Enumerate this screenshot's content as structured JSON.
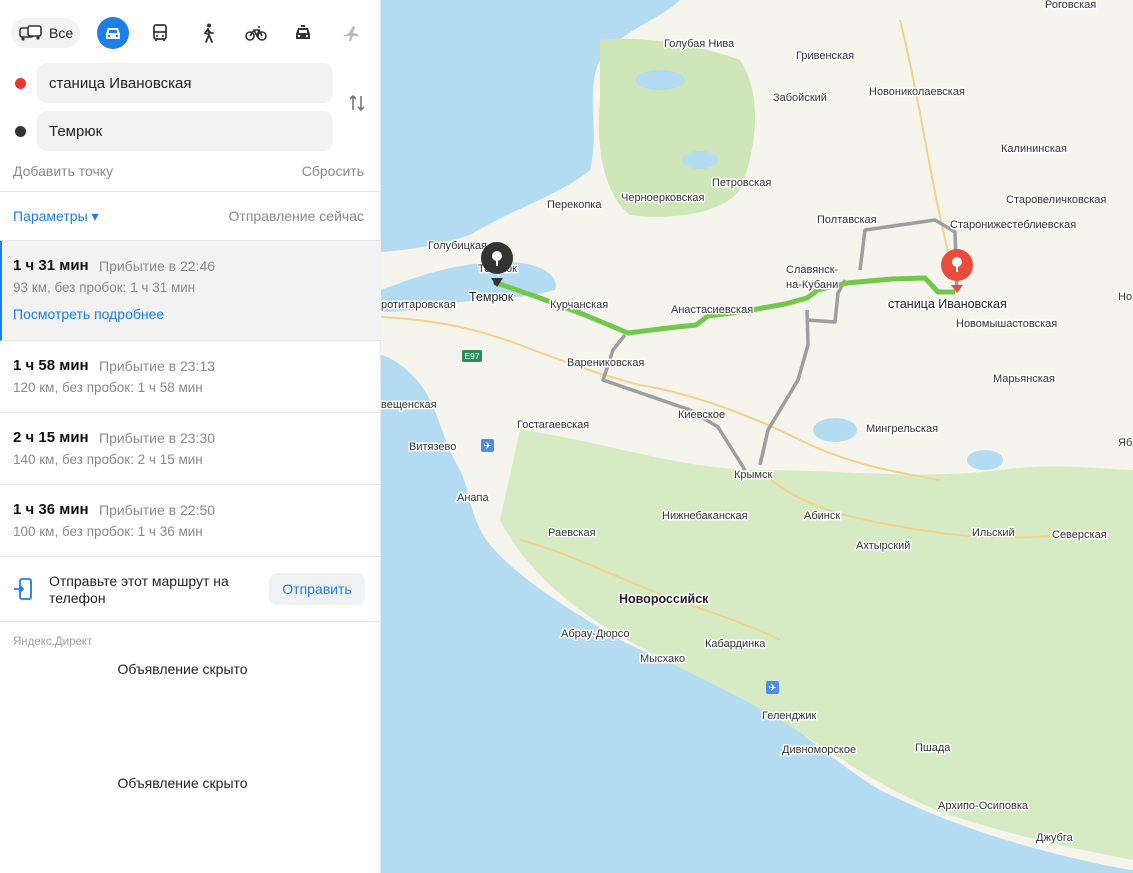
{
  "transport_modes": {
    "all_label": "Все",
    "modes": [
      "car-icon",
      "bus-icon",
      "walk-icon",
      "bike-icon",
      "taxi-icon",
      "plane-icon"
    ],
    "active": "car-icon"
  },
  "route_points": {
    "from": "станица Ивановская",
    "to": "Темрюк",
    "from_color": "#e8372f",
    "to_color": "#333333"
  },
  "actions": {
    "add_point": "Добавить точку",
    "reset": "Сбросить",
    "params": "Параметры ▾",
    "departure": "Отправление сейчас"
  },
  "routes": [
    {
      "duration": "1 ч 31 мин",
      "arrival": "Прибытие в 22:46",
      "distance": "93 км, без пробок: 1 ч 31 мин",
      "details": "Посмотреть подробнее",
      "selected": true
    },
    {
      "duration": "1 ч 58 мин",
      "arrival": "Прибытие в 23:13",
      "distance": "120 км, без пробок: 1 ч 58 мин"
    },
    {
      "duration": "2 ч 15 мин",
      "arrival": "Прибытие в 23:30",
      "distance": "140 км, без пробок: 2 ч 15 мин"
    },
    {
      "duration": "1 ч 36 мин",
      "arrival": "Прибытие в 22:50",
      "distance": "100 км, без пробок: 1 ч 36 мин"
    }
  ],
  "send": {
    "text": "Отправьте этот маршрут на телефон",
    "button": "Отправить"
  },
  "ads": {
    "source": "Яндекс.Директ",
    "hidden_1": "Объявление скрыто",
    "hidden_2": "Объявление скрыто"
  },
  "map": {
    "colors": {
      "sea": "#b3dcf3",
      "land": "#f5f4ed",
      "forest": "#d6ebc4",
      "route_main": "#72c84c",
      "route_alt": "#9e9e9e",
      "pin_end": "#ea4c3b",
      "pin_start": "#333333"
    },
    "labels": {
      "rogovskaya": "Роговская",
      "golubaya_niva": "Голубая Нива",
      "grivenskaya": "Гривенская",
      "zabojskij": "Забойский",
      "novonikolaevskaya": "Новониколаевская",
      "kalininskaya": "Калининская",
      "petrovskaya": "Петровская",
      "starovelichkovskaya": "Старовеличковская",
      "perekopka": "Перекопка",
      "chernoerkovskaya": "Черноерковская",
      "poltavskaya": "Полтавская",
      "staronizhestebl": "Старонижестеблиевская",
      "golubitskaya": "Голубицкая",
      "slavyansk": "Славянск-",
      "slavyansk2": "на-Кубани",
      "temryuk_map": "Темрюк",
      "temryuk_pin": "Темрюк",
      "ivanovskaya": "станица Ивановская",
      "no": "Но",
      "frontitarovskaya": "ротитаровская",
      "kurchanskaya": "Курчанская",
      "anastasievskaya": "Анастасиевская",
      "novomyshastovskaya": "Новомышастовская",
      "e97": "E97",
      "varenikovskaya": "Варениковская",
      "maryanskaya": "Марьянская",
      "veschenskaya": "вещенская",
      "kievskoe": "Киевское",
      "gostagaevskaya": "Гостагаевская",
      "mingrelskaya": "Мингрельская",
      "vityazevo": "Витязево",
      "ya": "Яб",
      "krymsk": "Крымск",
      "anapa": "Анапа",
      "nizhnebakanskaya": "Нижнебаканская",
      "abinsk": "Абинск",
      "raevskaya": "Раевская",
      "ilskij": "Ильский",
      "severskaya": "Северская",
      "ahtyrskij": "Ахтырский",
      "novorossijsk": "Новороссийск",
      "abrau": "Абрау-Дюрсо",
      "kabardinka": "Кабардинка",
      "myshako": "Мысхако",
      "gelendzhik": "Геленджик",
      "divnomorskoe": "Дивноморское",
      "pshada": "Пшада",
      "arhipo": "Архипо-Осиповка",
      "dzhubga": "Джубга"
    }
  }
}
